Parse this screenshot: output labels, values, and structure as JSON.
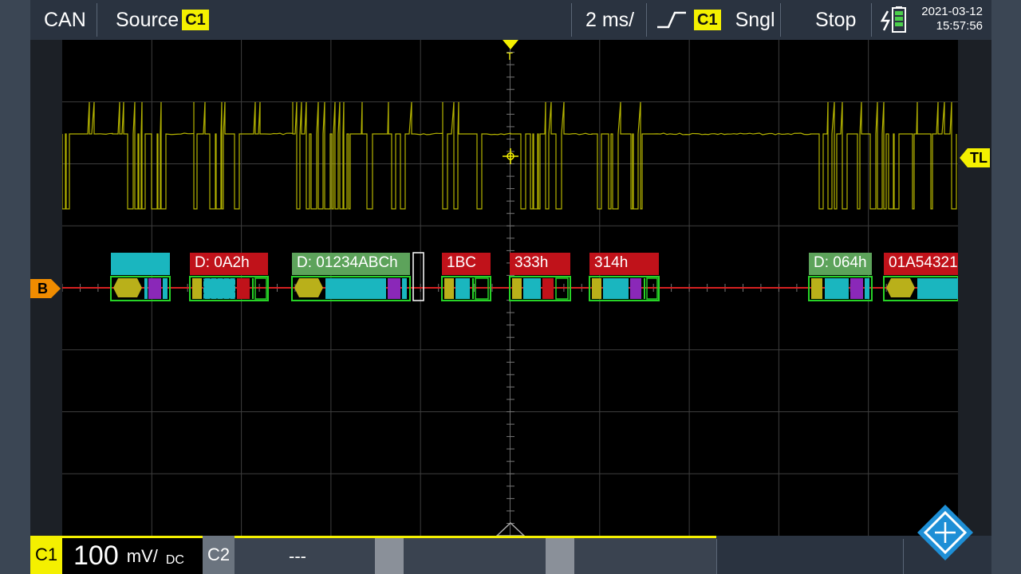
{
  "topbar": {
    "protocol": "CAN",
    "source_label": "Source",
    "source_channel": "C1",
    "timebase": "2 ms/",
    "trigger_channel": "C1",
    "trigger_mode": "Sngl",
    "run_state": "Stop",
    "date": "2021-03-12",
    "time": "15:57:56"
  },
  "markers": {
    "bus": "B",
    "trigger_top": "T",
    "trigger_level": "TL"
  },
  "frames": [
    {
      "label": "",
      "color": "#1ab6bf"
    },
    {
      "label": "D: 0A2h",
      "color": "#c0121a"
    },
    {
      "label": "D: 01234ABCh",
      "color": "#5da35b"
    },
    {
      "label": "1BC",
      "color": "#c0121a"
    },
    {
      "label": "333h",
      "color": "#c0121a"
    },
    {
      "label": "314h",
      "color": "#c0121a"
    },
    {
      "label": "D: 064h",
      "color": "#5da35b"
    },
    {
      "label": "01A54321",
      "color": "#c0121a"
    }
  ],
  "bottombar": {
    "ch1_name": "C1",
    "ch1_scale": "100",
    "ch1_unit": "mV/",
    "ch1_coupling": "DC",
    "ch2_name": "C2",
    "ch2_value": "---"
  },
  "colors": {
    "waveform": "#c9c800",
    "bus_line": "#d62020",
    "accent_yellow": "#f4f000",
    "marker_orange": "#f08c00",
    "logo_blue": "#1e8fd6"
  }
}
